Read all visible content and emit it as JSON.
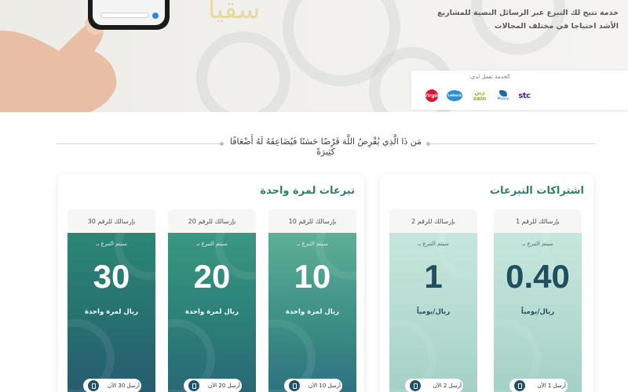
{
  "hero": {
    "description_line1": "خدمة تتيح لك التبرع عبر الرسائل النصية للمشاريع",
    "description_line2": "الأشد احتياجا في مختلف المجالات",
    "operators_title": "الخدمة تعمل لدى:",
    "operators": [
      {
        "name": "virgin",
        "label": "Virgin"
      },
      {
        "name": "lebara",
        "label": "Lebara"
      },
      {
        "name": "zain",
        "label": "زين zain"
      },
      {
        "name": "mobily",
        "label": "Mobily"
      },
      {
        "name": "stc",
        "label": "stc"
      }
    ]
  },
  "verse": "مَن ذَا الَّذِي يُقْرِضُ اللَّهَ قَرْضًا حَسَنًا فَيُضَاعِفَهُ لَهُ أَضْعَافًا كَثِيرَةً",
  "subscriptions": {
    "title": "اشتراكات التبرعات",
    "cards": [
      {
        "head": "بإرسالك للرقم 1",
        "sub": "سيتم التبرع بـ",
        "amount": "0.40",
        "unit": "ريال/يومياً",
        "button": "أرسل 1 الآن"
      },
      {
        "head": "بإرسالك للرقم 2",
        "sub": "سيتم التبرع بـ",
        "amount": "1",
        "unit": "ريال/يومياً",
        "button": "أرسل 2 الآن"
      }
    ]
  },
  "one_time": {
    "title": "تبرعات لمرة واحدة",
    "cards": [
      {
        "head": "بإرسالك للرقم 10",
        "sub": "سيتم التبرع بـ",
        "amount": "10",
        "unit": "ريال لمرة واحدة",
        "button": "أرسل 10 الآن"
      },
      {
        "head": "بإرسالك للرقم 20",
        "sub": "سيتم التبرع بـ",
        "amount": "20",
        "unit": "ريال لمرة واحدة",
        "button": "أرسل 20 الآن"
      },
      {
        "head": "بإرسالك للرقم 30",
        "sub": "سيتم التبرع بـ",
        "amount": "30",
        "unit": "ريال لمرة واحدة",
        "button": "أرسل 30 الآن"
      }
    ]
  }
}
